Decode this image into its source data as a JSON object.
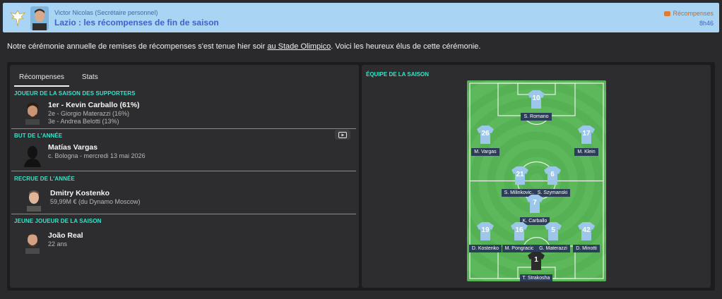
{
  "header": {
    "sender": "Victor Nicolas  (Secrétaire personnel)",
    "subject": "Lazio : les récompenses de fin de saison",
    "tag": "Récompenses",
    "time": "8h46"
  },
  "intro": {
    "before": "Notre cérémonie annuelle de remises de récompenses s'est tenue hier soir ",
    "link": "au Stade Olimpico",
    "after": ". Voici les heureux élus de cette cérémonie."
  },
  "tabs": [
    "Récompenses",
    "Stats"
  ],
  "awards": {
    "fans_player": {
      "title": "JOUEUR DE LA SAISON DES SUPPORTERS",
      "winner": "1er - Kevin Carballo (61%)",
      "second": "2e - Giorgio Materazzi (16%)",
      "third": "3e - Andrea Belotti (13%)"
    },
    "goal": {
      "title": "BUT DE L'ANNÉE",
      "winner": "Matías Vargas",
      "detail": "c. Bologna - mercredi 13 mai 2026"
    },
    "signing": {
      "title": "RECRUE DE L'ANNÉE",
      "winner": "Dmitry Kostenko",
      "detail": "59,99M € (du Dynamo Moscow)"
    },
    "young": {
      "title": "JEUNE JOUEUR DE LA SAISON",
      "winner": "João Real",
      "detail": "22 ans"
    }
  },
  "team": {
    "title": "ÉQUIPE DE LA SAISON",
    "players": [
      {
        "number": "10",
        "name": "S. Romano"
      },
      {
        "number": "26",
        "name": "M. Vargas"
      },
      {
        "number": "17",
        "name": "M. Klein"
      },
      {
        "number": "21",
        "name": "S. Milinkovic..."
      },
      {
        "number": "6",
        "name": "S. Szymanski"
      },
      {
        "number": "7",
        "name": "K. Carballo"
      },
      {
        "number": "19",
        "name": "D. Kostenko"
      },
      {
        "number": "16",
        "name": "M. Pongracic"
      },
      {
        "number": "5",
        "name": "G. Materazzi"
      },
      {
        "number": "42",
        "name": "D. Minotti"
      },
      {
        "number": "1",
        "name": "T. Strakosha"
      }
    ]
  },
  "colors": {
    "accent": "#3de0c8",
    "header_bg": "#a9d4f3",
    "shirt": "#9cc7ea",
    "keeper_shirt": "#2b2b2b",
    "pitch": "#5db85b"
  }
}
